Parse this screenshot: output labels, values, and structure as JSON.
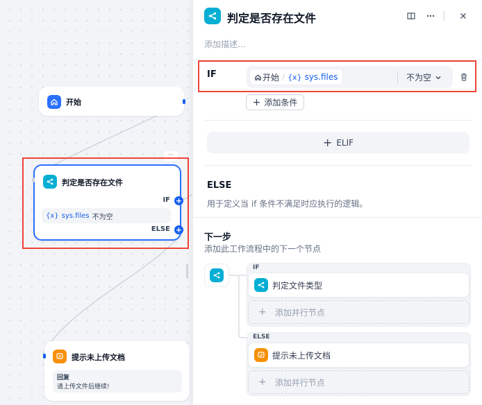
{
  "canvas": {
    "start_node": {
      "title": "开始"
    },
    "if_node": {
      "title": "判定是否存在文件",
      "if_label": "IF",
      "else_label": "ELSE",
      "cond_var": "sys.files",
      "cond_op": "不为空",
      "var_symbol": "{x}"
    },
    "hint_node": {
      "title": "提示未上传文档",
      "reply_label": "回复",
      "reply_text": "请上传文件后继续!"
    },
    "more_dots": "···"
  },
  "panel": {
    "title": "判定是否存在文件",
    "description_placeholder": "添加描述...",
    "if_label": "IF",
    "condition": {
      "node_name": "开始",
      "separator": "/",
      "var_symbol": "{x}",
      "var_name": "sys.files",
      "operator": "不为空"
    },
    "add_condition": "添加条件",
    "elif_button": "ELIF",
    "else_title": "ELSE",
    "else_desc": "用于定义当 if 条件不满足时应执行的逻辑。",
    "next_step_title": "下一步",
    "next_step_desc": "添加此工作流程中的下一个节点",
    "branches": [
      {
        "label": "IF",
        "node": "判定文件类型",
        "add_parallel": "添加并行节点"
      },
      {
        "label": "ELSE",
        "node": "提示未上传文档",
        "add_parallel": "添加并行节点"
      }
    ]
  },
  "colors": {
    "accent": "#155eef",
    "if_node_icon": "#06aed4",
    "start_icon": "#2970ff",
    "answer_icon": "#f79009",
    "highlight_red": "#f04438"
  }
}
